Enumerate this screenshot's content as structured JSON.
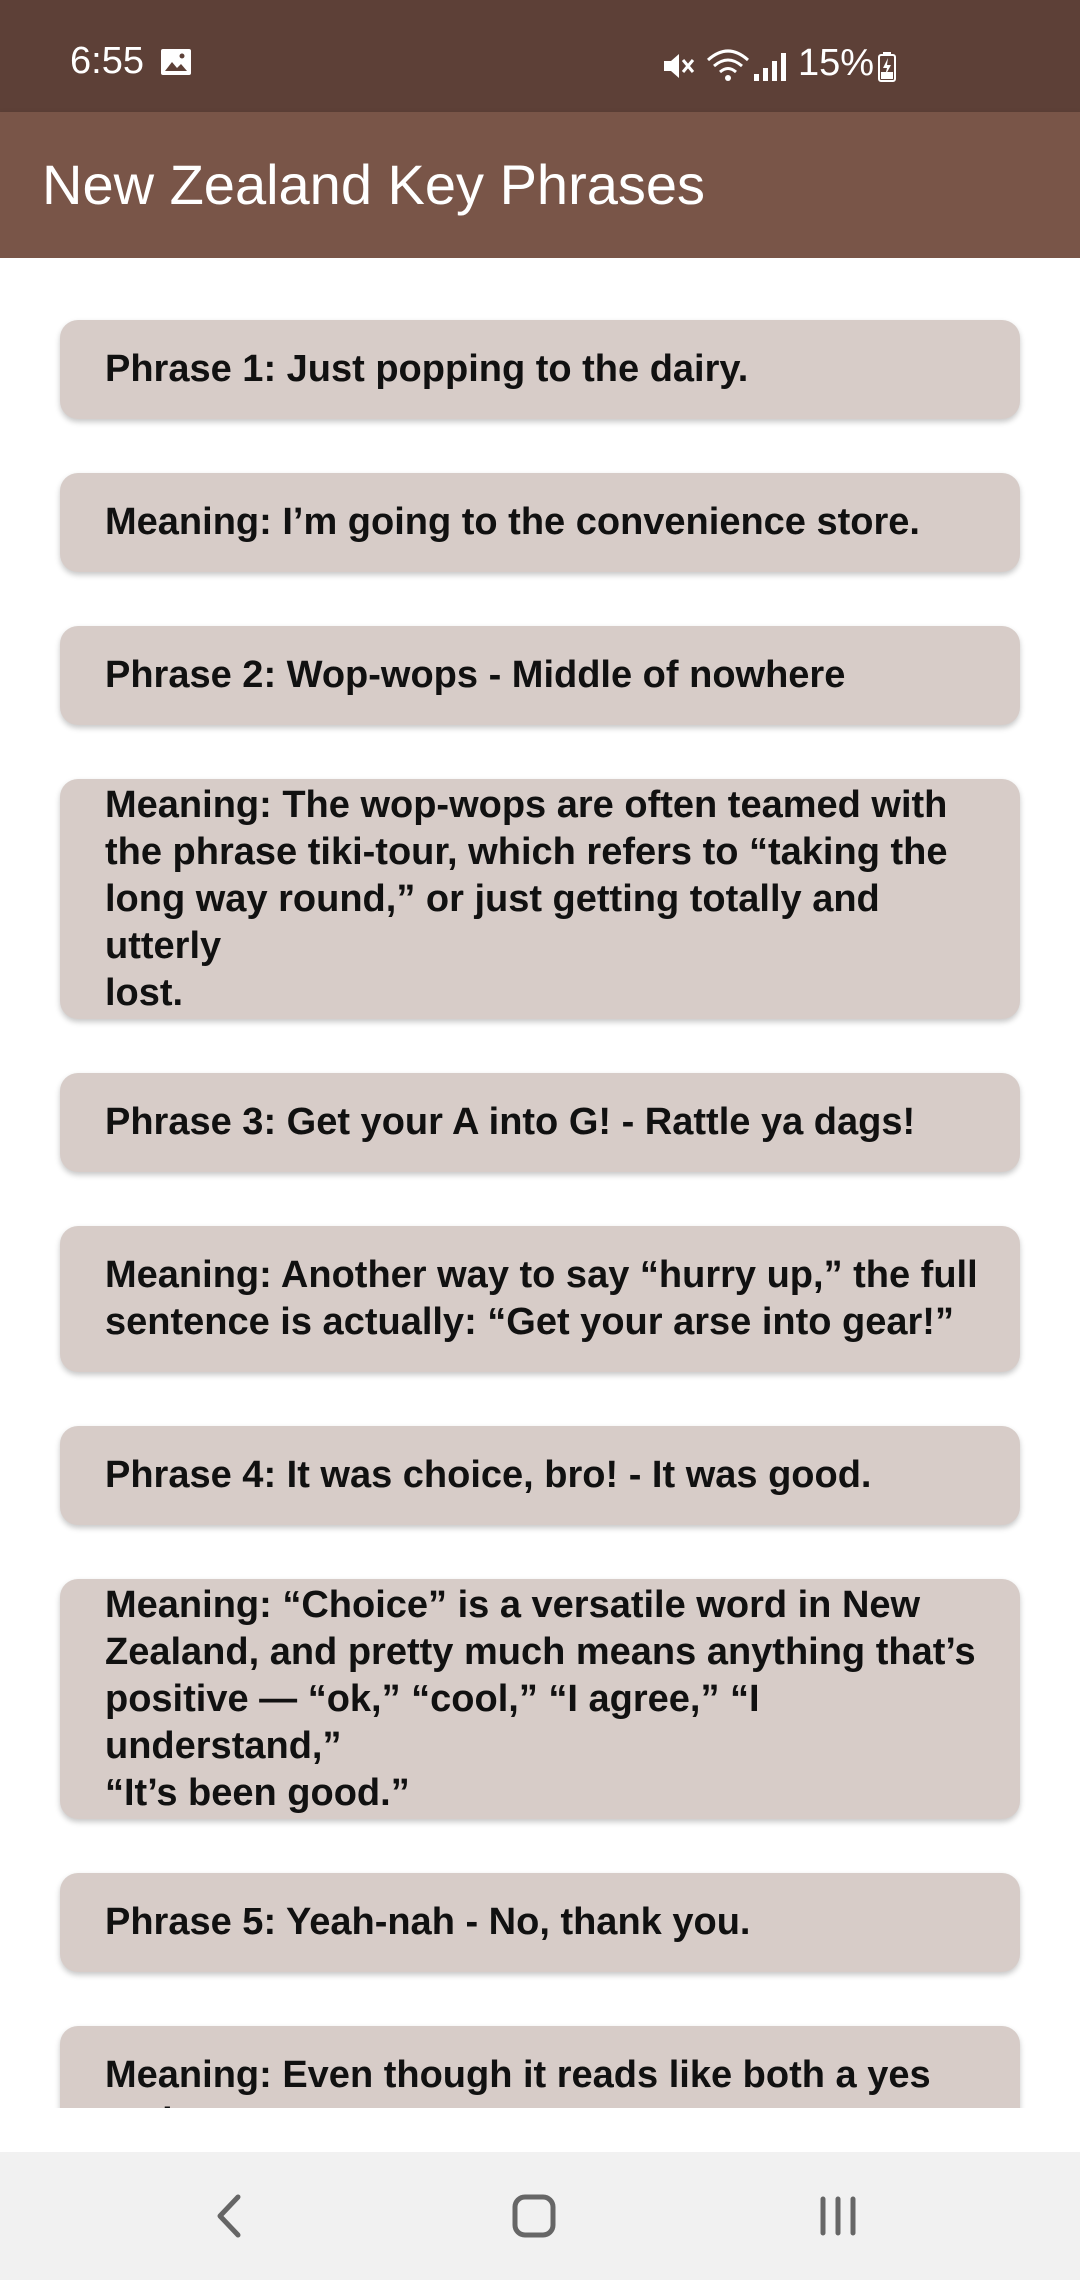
{
  "status_bar": {
    "time": "6:55",
    "battery": "15%",
    "icons": [
      "gallery-icon",
      "mute-icon",
      "wifi-icon",
      "signal-icon",
      "battery-charging-icon"
    ]
  },
  "app_bar": {
    "title": "New Zealand Key Phrases"
  },
  "cards": [
    {
      "text": "Phrase 1: Just popping to the dairy."
    },
    {
      "text": "Meaning: I’m going to the convenience store."
    },
    {
      "text": "Phrase 2: Wop-wops - Middle of nowhere"
    },
    {
      "text": "Meaning: The wop-wops are often teamed with\nthe phrase tiki-tour, which refers to “taking the\nlong way round,” or just getting totally and utterly\nlost."
    },
    {
      "text": "Phrase 3: Get your A into G! - Rattle ya dags!"
    },
    {
      "text": "Meaning: Another way to say “hurry up,” the full\nsentence is actually: “Get your arse into gear!”"
    },
    {
      "text": "Phrase 4: It was choice, bro! - It was good."
    },
    {
      "text": "Meaning: “Choice” is a versatile word in New\nZealand, and pretty much means anything that’s\npositive — “ok,” “cool,” “I agree,” “I understand,”\n“It’s been good.”"
    },
    {
      "text": "Phrase 5: Yeah-nah - No, thank you."
    },
    {
      "text": "Meaning: Even though it reads like both a yes and"
    }
  ],
  "nav_bar": {
    "icons": [
      "back-icon",
      "home-icon",
      "recents-icon"
    ]
  },
  "colors": {
    "status_bar": "#5d4037",
    "app_bar": "#795548",
    "card": "#d7ccc8"
  }
}
